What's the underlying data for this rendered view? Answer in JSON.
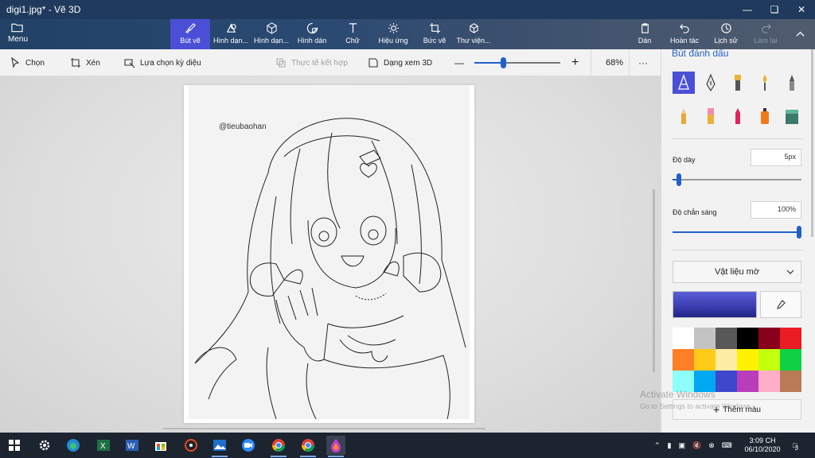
{
  "window": {
    "title": "digi1.jpg* - Vẽ 3D"
  },
  "ribbon": {
    "menu_label": "Menu",
    "tabs": [
      {
        "label": "Bút vẽ",
        "icon": "brush-icon",
        "active": true
      },
      {
        "label": "Hình dạn...",
        "icon": "2d-shapes-icon"
      },
      {
        "label": "Hình dạn...",
        "icon": "3d-shapes-icon"
      },
      {
        "label": "Hình dán",
        "icon": "stickers-icon"
      },
      {
        "label": "Chữ",
        "icon": "text-icon"
      },
      {
        "label": "Hiệu ứng",
        "icon": "effects-icon"
      },
      {
        "label": "Bức vẽ",
        "icon": "canvas-icon"
      },
      {
        "label": "Thư viện...",
        "icon": "3d-library-icon"
      }
    ],
    "right": [
      {
        "label": "Dán",
        "icon": "paste-icon"
      },
      {
        "label": "Hoàn tác",
        "icon": "undo-icon"
      },
      {
        "label": "Lịch sử",
        "icon": "history-icon"
      },
      {
        "label": "Làm lại",
        "icon": "redo-icon",
        "disabled": true
      }
    ]
  },
  "toolbar": {
    "select_label": "Chọn",
    "crop_label": "Xén",
    "magic_select_label": "Lựa chọn kỳ diệu",
    "mixed_reality_label": "Thực tế kết hợp",
    "view_3d_label": "Dạng xem 3D",
    "zoom_minus": "—",
    "zoom_plus": "+",
    "zoom_percent": "68%",
    "zoom_level": 0.33,
    "more": "···"
  },
  "canvas": {
    "watermark": "@tieubaohan"
  },
  "panel": {
    "title": "Bút đánh dấu",
    "brushes": [
      "marker-icon",
      "calligraphy-pen-icon",
      "oil-brush-icon",
      "watercolor-icon",
      "pixel-pen-icon",
      "pencil-icon",
      "eraser-icon",
      "crayon-icon",
      "spray-can-icon",
      "fill-icon"
    ],
    "thickness_label": "Độ dày",
    "thickness_value": "5px",
    "thickness_level": 0.05,
    "opacity_label": "Độ chắn sáng",
    "opacity_value": "100%",
    "opacity_level": 1.0,
    "material_label": "Vật liệu mờ",
    "current_color": "#3a3cae",
    "swatches": [
      "#ffffff",
      "#c3c3c3",
      "#585858",
      "#000000",
      "#88001b",
      "#ec1c24",
      "#ff7f27",
      "#ffca18",
      "#fdeca6",
      "#fff200",
      "#c4ff0e",
      "#0ed145",
      "#8cfffb",
      "#00a8f3",
      "#3f48cc",
      "#b83dba",
      "#ffaec8",
      "#b97a56"
    ],
    "add_color_label": "Thêm màu"
  },
  "watermark_activate": {
    "line1": "Activate Windows",
    "line2": "Go to Settings to activate Windows."
  },
  "taskbar": {
    "apps": [
      "windows-start-icon",
      "settings-icon",
      "edge-icon",
      "excel-icon",
      "word-icon",
      "store-icon",
      "media-icon",
      "photos-icon",
      "zoom-icon",
      "chrome-icon",
      "chrome-icon-2",
      "paint-3d-icon"
    ],
    "time": "3:09 CH",
    "date": "06/10/2020",
    "notifications": "3"
  }
}
